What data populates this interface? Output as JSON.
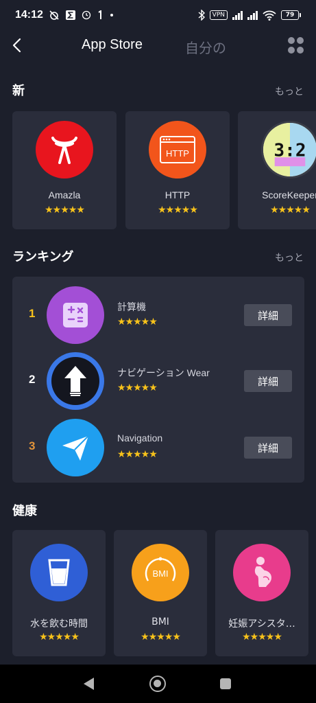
{
  "status_bar": {
    "time": "14:12",
    "left_icons": [
      "mute-alarm-icon",
      "sigma-icon",
      "clock-icon",
      "one-icon",
      "dot-icon"
    ],
    "vpn": "VPN",
    "battery": "79"
  },
  "header": {
    "tab_store": "App Store",
    "tab_mine": "自分の"
  },
  "new_section": {
    "title": "新",
    "more": "もっと",
    "apps": [
      {
        "name": "Amazla",
        "icon": "amazla-logo-icon",
        "color": "#e8151e"
      },
      {
        "name": "HTTP",
        "icon": "http-window-icon",
        "color": "#f2551b",
        "icon_text": "HTTP"
      },
      {
        "name": "ScoreKeeper",
        "icon": "score-display-icon",
        "color": "#f2e6a8",
        "icon_text": "3:2"
      }
    ]
  },
  "ranking_section": {
    "title": "ランキング",
    "more": "もっと",
    "items": [
      {
        "rank": "1",
        "rank_color": "#f7c21b",
        "name": "計算機",
        "icon": "calculator-icon",
        "button": "詳細"
      },
      {
        "rank": "2",
        "rank_color": "#ffffff",
        "name": "ナビゲーション Wear",
        "icon": "up-arrow-icon",
        "button": "詳細"
      },
      {
        "rank": "3",
        "rank_color": "#e0933a",
        "name": "Navigation",
        "icon": "paper-plane-icon",
        "button": "詳細"
      }
    ]
  },
  "health_section": {
    "title": "健康",
    "apps": [
      {
        "name": "水を飲む時間",
        "icon": "water-glass-icon",
        "color": "#2f5fd6"
      },
      {
        "name": "BMI",
        "icon": "bmi-gauge-icon",
        "color": "#f7a01b",
        "icon_text": "BMI"
      },
      {
        "name": "妊娠アシスタ…",
        "icon": "pregnancy-icon",
        "color": "#e83c8c"
      }
    ]
  },
  "rating": "★★★★★"
}
